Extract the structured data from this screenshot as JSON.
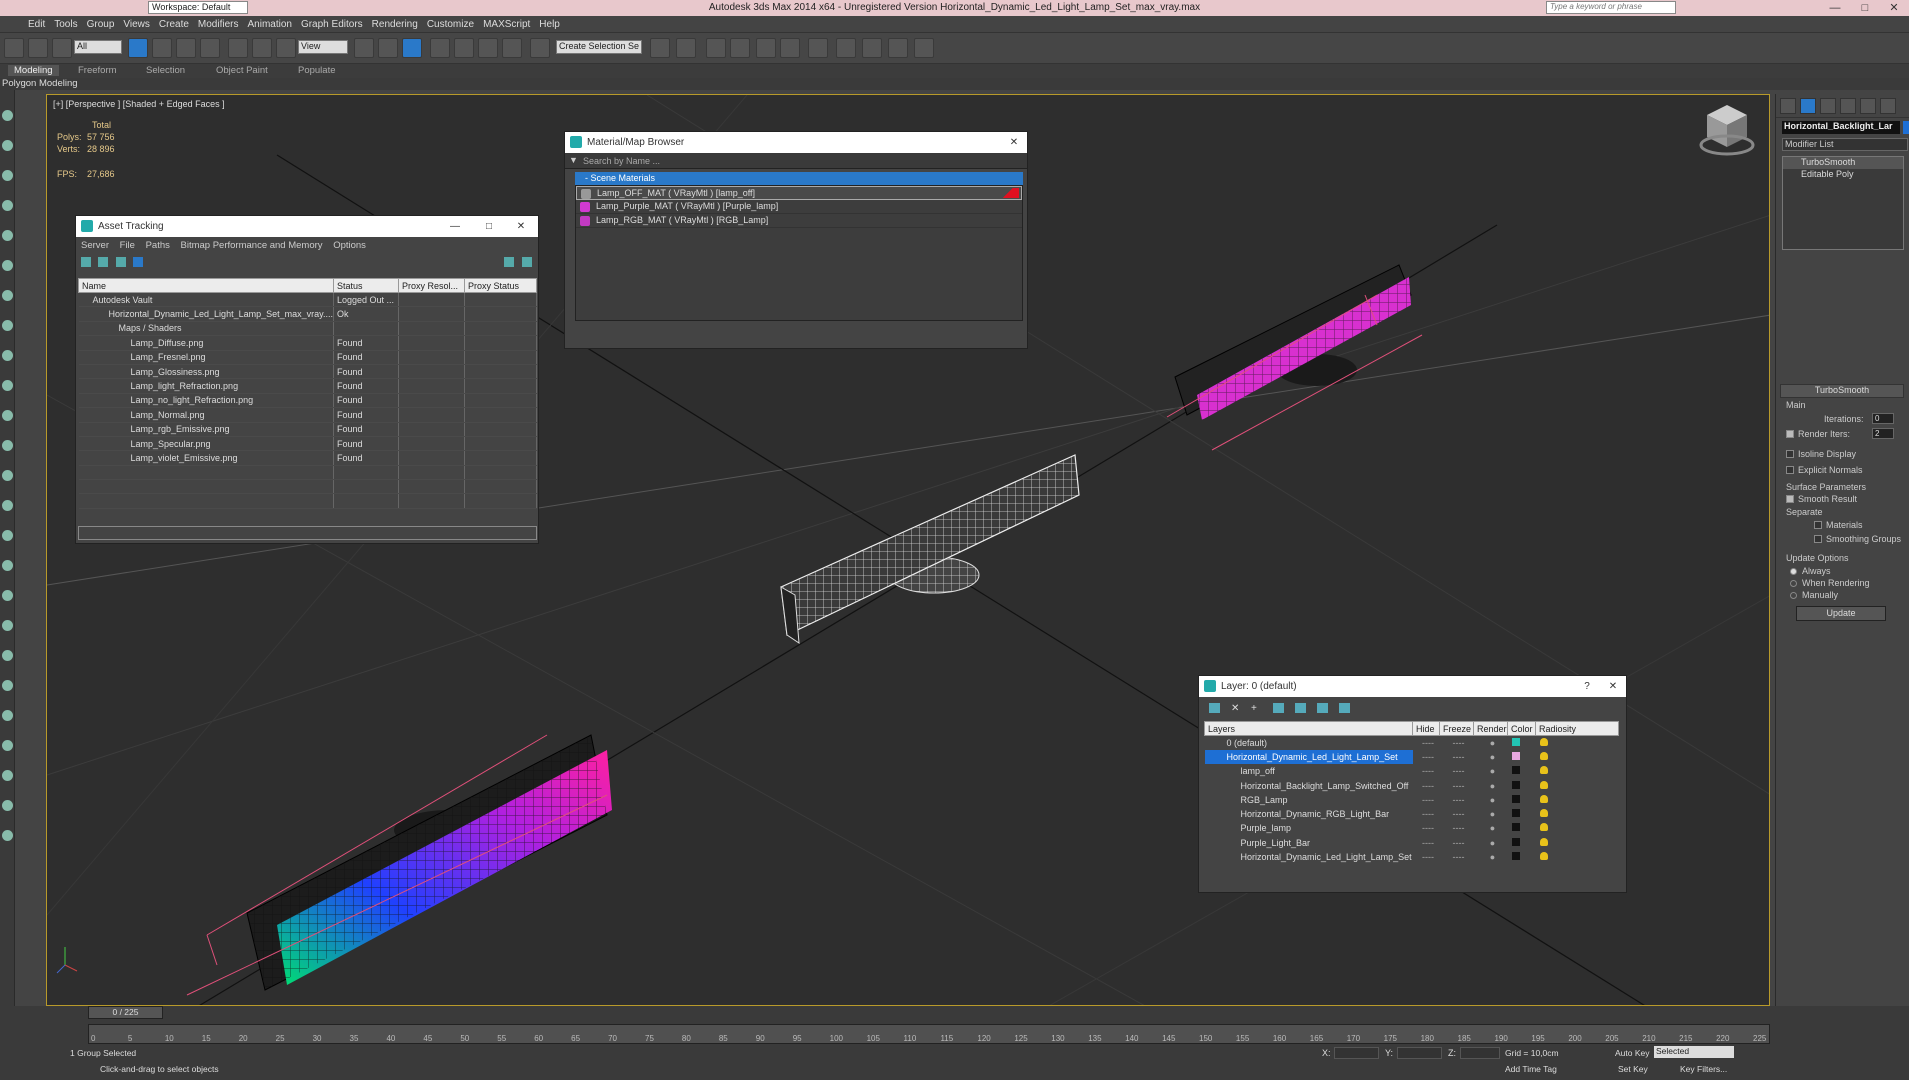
{
  "titlebar": {
    "title": "Autodesk 3ds Max  2014 x64  -  Unregistered Version    Horizontal_Dynamic_Led_Light_Lamp_Set_max_vray.max",
    "workspace": "Workspace: Default",
    "search_placeholder": "Type a keyword or phrase"
  },
  "menu": [
    "Edit",
    "Tools",
    "Group",
    "Views",
    "Create",
    "Modifiers",
    "Animation",
    "Graph Editors",
    "Rendering",
    "Customize",
    "MAXScript",
    "Help"
  ],
  "toolbar": {
    "filter": "All",
    "ref_coord": "View",
    "selection_set": "Create Selection Se"
  },
  "ribbon": {
    "tabs": [
      "Modeling",
      "Freeform",
      "Selection",
      "Object Paint",
      "Populate"
    ],
    "sub": "Polygon Modeling"
  },
  "viewport": {
    "label": "[+] [Perspective ] [Shaded + Edged Faces ]",
    "stats_header": "Total",
    "polys_label": "Polys:",
    "polys": "57 756",
    "verts_label": "Verts:",
    "verts": "28 896",
    "fps_label": "FPS:",
    "fps": "27,686"
  },
  "asset_tracking": {
    "title": "Asset Tracking",
    "menu": [
      "Server",
      "File",
      "Paths",
      "Bitmap Performance and Memory",
      "Options"
    ],
    "columns": [
      "Name",
      "Status",
      "Proxy Resol...",
      "Proxy Status"
    ],
    "rows": [
      {
        "name": "Autodesk Vault",
        "status": "Logged Out ..."
      },
      {
        "name": "Horizontal_Dynamic_Led_Light_Lamp_Set_max_vray....",
        "status": "Ok"
      },
      {
        "name": "Maps / Shaders",
        "status": ""
      },
      {
        "name": "Lamp_Diffuse.png",
        "status": "Found"
      },
      {
        "name": "Lamp_Fresnel.png",
        "status": "Found"
      },
      {
        "name": "Lamp_Glossiness.png",
        "status": "Found"
      },
      {
        "name": "Lamp_light_Refraction.png",
        "status": "Found"
      },
      {
        "name": "Lamp_no_light_Refraction.png",
        "status": "Found"
      },
      {
        "name": "Lamp_Normal.png",
        "status": "Found"
      },
      {
        "name": "Lamp_rgb_Emissive.png",
        "status": "Found"
      },
      {
        "name": "Lamp_Specular.png",
        "status": "Found"
      },
      {
        "name": "Lamp_violet_Emissive.png",
        "status": "Found"
      }
    ]
  },
  "material_browser": {
    "title": "Material/Map Browser",
    "search": "Search by Name ...",
    "section": "- Scene Materials",
    "items": [
      {
        "label": "Lamp_OFF_MAT  ( VRayMtl )  [lamp_off]",
        "color": "#999999"
      },
      {
        "label": "Lamp_Purple_MAT  ( VRayMtl )  [Purple_lamp]",
        "color": "#d13ad1"
      },
      {
        "label": "Lamp_RGB_MAT  ( VRayMtl )  [RGB_Lamp]",
        "color": "#c23ac2"
      }
    ]
  },
  "layer_manager": {
    "title": "Layer: 0 (default)",
    "help": "?",
    "columns": [
      "Layers",
      "Hide",
      "Freeze",
      "Render",
      "Color",
      "Radiosity"
    ],
    "rows": [
      {
        "name": "0 (default)",
        "color": "#22c4b4"
      },
      {
        "name": "Horizontal_Dynamic_Led_Light_Lamp_Set",
        "color": "#e8a8e0"
      },
      {
        "name": "lamp_off",
        "color": "#111111"
      },
      {
        "name": "Horizontal_Backlight_Lamp_Switched_Off",
        "color": "#111111"
      },
      {
        "name": "RGB_Lamp",
        "color": "#111111"
      },
      {
        "name": "Horizontal_Dynamic_RGB_Light_Bar",
        "color": "#111111"
      },
      {
        "name": "Purple_lamp",
        "color": "#111111"
      },
      {
        "name": "Purple_Light_Bar",
        "color": "#111111"
      },
      {
        "name": "Horizontal_Dynamic_Led_Light_Lamp_Set",
        "color": "#111111"
      }
    ],
    "dash": "----"
  },
  "command_panel": {
    "object_name": "Horizontal_Backlight_Lar",
    "modifier_list": "Modifier List",
    "stack": [
      "TurboSmooth",
      "Editable Poly"
    ],
    "rollout": "TurboSmooth",
    "main": "Main",
    "iterations_label": "Iterations:",
    "iterations": "0",
    "render_iters_label": "Render Iters:",
    "render_iters": "2",
    "isoline": "Isoline Display",
    "explicit": "Explicit Normals",
    "surface_params": "Surface Parameters",
    "smooth_result": "Smooth Result",
    "separate": "Separate",
    "materials": "Materials",
    "smoothing_groups": "Smoothing Groups",
    "update_options": "Update Options",
    "always": "Always",
    "when_rendering": "When Rendering",
    "manually": "Manually",
    "update": "Update"
  },
  "timeline": {
    "slider": "0 / 225",
    "ticks": [
      "0",
      "5",
      "10",
      "15",
      "20",
      "25",
      "30",
      "35",
      "40",
      "45",
      "50",
      "55",
      "60",
      "65",
      "70",
      "75",
      "80",
      "85",
      "90",
      "95",
      "100",
      "105",
      "110",
      "115",
      "120",
      "125",
      "130",
      "135",
      "140",
      "145",
      "150",
      "155",
      "160",
      "165",
      "170",
      "175",
      "180",
      "185",
      "190",
      "195",
      "200",
      "205",
      "210",
      "215",
      "220",
      "225"
    ],
    "status": "1 Group Selected",
    "prompt": "Click-and-drag to select objects",
    "x": "X:",
    "y": "Y:",
    "z": "Z:",
    "grid": "Grid = 10,0cm",
    "add_time_tag": "Add Time Tag",
    "auto_key": "Auto Key",
    "set_key": "Set Key",
    "key_mode": "Selected",
    "key_filters": "Key Filters..."
  }
}
